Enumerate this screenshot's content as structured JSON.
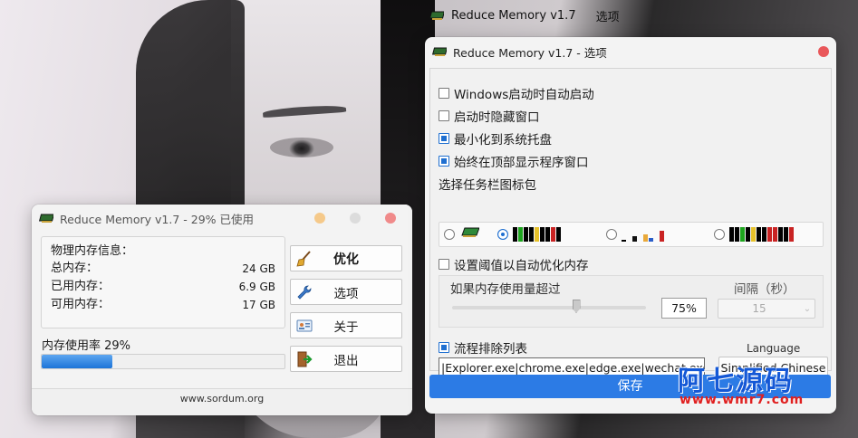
{
  "desktop": {
    "background_title": "Reduce Memory v1.7",
    "background_title_suffix": "选项"
  },
  "main_window": {
    "title": "Reduce Memory v1.7 - 29% 已使用",
    "memory_info": {
      "heading": "物理内存信息：",
      "rows": [
        {
          "label": "总内存：",
          "value": "24 GB"
        },
        {
          "label": "已用内存：",
          "value": "6.9 GB"
        },
        {
          "label": "可用内存：",
          "value": "17 GB"
        }
      ]
    },
    "usage_label": "内存使用率 29%",
    "usage_fraction": 0.29,
    "buttons": {
      "optimize": "优化",
      "options": "选项",
      "about": "关于",
      "exit": "退出"
    },
    "footer": "www.sordum.org"
  },
  "options_window": {
    "title": "Reduce Memory v1.7 - 选项",
    "checkboxes": [
      {
        "label": "Windows启动时自动启动",
        "checked": false
      },
      {
        "label": "启动时隐藏窗口",
        "checked": false
      },
      {
        "label": "最小化到系统托盘",
        "checked": true
      },
      {
        "label": "始终在顶部显示程序窗口",
        "checked": true
      }
    ],
    "icon_pack_label": "选择任务栏图标包",
    "icon_pack_selected": 1,
    "threshold": {
      "checkbox_label": "设置阈值以自动优化内存",
      "checked": false,
      "usage_label": "如果内存使用量超过",
      "interval_label": "间隔（秒）",
      "percent": "75%",
      "slider_value": 0.75,
      "interval_value": "15"
    },
    "exclusion": {
      "checkbox_label": "流程排除列表",
      "checked": true,
      "value": "|Explorer.exe|chrome.exe|edge.exe|wechat.exe|"
    },
    "language_label": "Language",
    "language_value": "Simplified Chinese",
    "save_label": "保存",
    "colors": {
      "accent": "#2c7be5",
      "close": "#e9575a"
    }
  },
  "watermark": {
    "line1": "阿七源码",
    "line2": "www.wmr7.com"
  }
}
